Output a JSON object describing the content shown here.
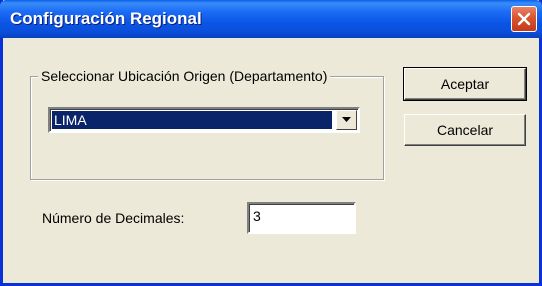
{
  "window": {
    "title": "Configuración Regional",
    "close_icon": "close-icon"
  },
  "location": {
    "group_label": "Seleccionar Ubicación Origen (Departamento)",
    "selected": "LIMA",
    "arrow_icon": "chevron-down-icon"
  },
  "decimals": {
    "label": "Número de Decimales:",
    "value": "3"
  },
  "buttons": {
    "accept": "Aceptar",
    "cancel": "Cancelar"
  },
  "colors": {
    "titlebar": "#0A4FD8",
    "close": "#D9542F",
    "dialog_bg": "#ECE9D8",
    "selection": "#0A246A"
  }
}
